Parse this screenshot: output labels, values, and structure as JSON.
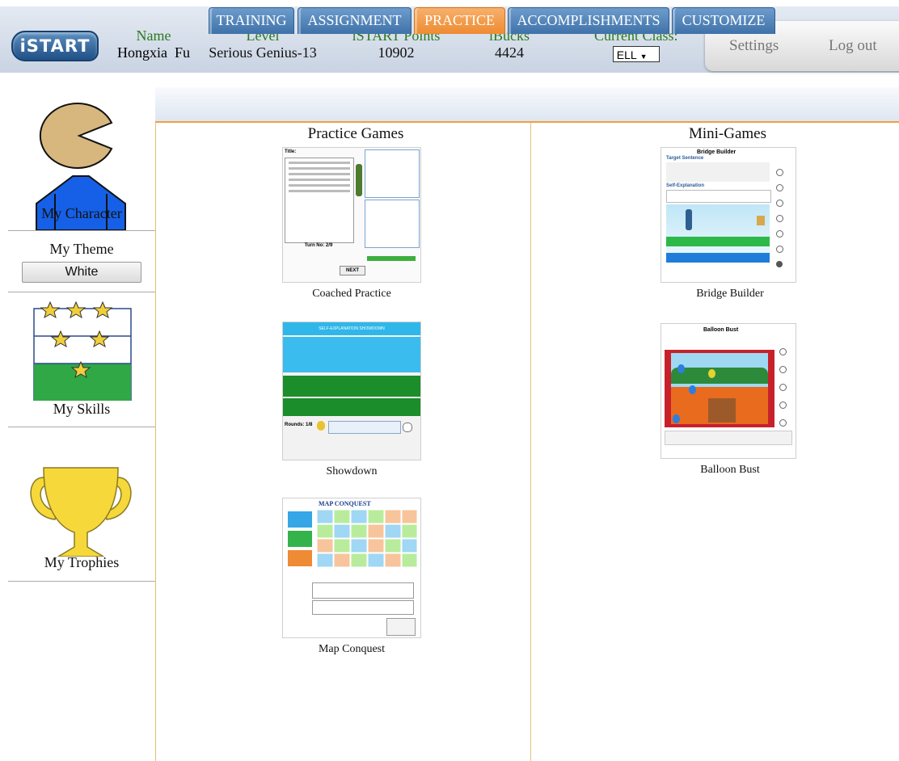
{
  "header": {
    "logo": "iSTART",
    "name_label": "Name",
    "name_value": "Hongxia  Fu",
    "level_label": "Level",
    "level_value": "Serious Genius-13",
    "points_label": "iSTART Points",
    "points_value": "10902",
    "ibucks_label": "iBucks",
    "ibucks_value": "4424",
    "class_label": "Current Class:",
    "class_value": "ELL",
    "settings": "Settings",
    "logout": "Log out"
  },
  "sidebar": {
    "character": "My Character",
    "theme_title": "My Theme",
    "theme_button": "White",
    "skills": "My Skills",
    "trophies": "My Trophies"
  },
  "tabs": [
    "TRAINING",
    "ASSIGNMENT",
    "PRACTICE",
    "ACCOMPLISHMENTS",
    "CUSTOMIZE"
  ],
  "active_tab": "PRACTICE",
  "practice": {
    "title": "Practice Games",
    "games": [
      "Coached Practice",
      "Showdown",
      "Map Conquest"
    ]
  },
  "mini": {
    "title": "Mini-Games",
    "games": [
      "Bridge Builder",
      "Balloon Bust"
    ]
  },
  "thumbs": {
    "coached_title": "Title:",
    "coached_turn": "Turn No: 2/9",
    "coached_next": "NEXT",
    "showdown_banner": "SELF-EXPLANATION SHOWDOWN",
    "showdown_rounds": "Rounds: 1/8",
    "map_title": "MAP CONQUEST",
    "bridge_title": "Bridge Builder",
    "bridge_target": "Target Sentence",
    "bridge_se": "Self-Explanation",
    "balloon_title": "Balloon Bust"
  },
  "colors": {
    "accent_tab": "#ee8b32",
    "tab": "#4a7db3",
    "label_green": "#2b7a1f"
  }
}
